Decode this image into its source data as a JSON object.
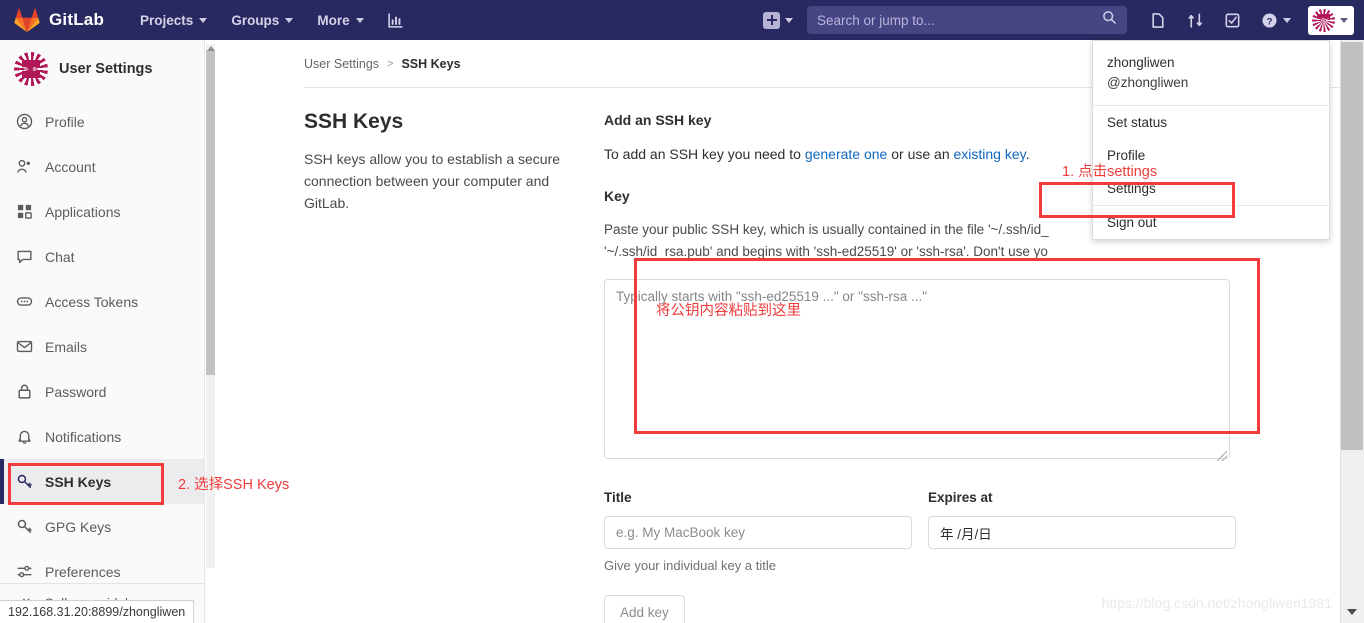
{
  "navbar": {
    "brand": "GitLab",
    "links": [
      {
        "label": "Projects",
        "name": "nav-projects"
      },
      {
        "label": "Groups",
        "name": "nav-groups"
      },
      {
        "label": "More",
        "name": "nav-more"
      }
    ],
    "analytics_icon": "chart-bar-icon",
    "create_new_icon": "plus-square-icon",
    "search": {
      "placeholder": "Search or jump to...",
      "value": "",
      "icon": "search-icon"
    },
    "icons": [
      {
        "name": "issues-icon"
      },
      {
        "name": "merge-requests-icon"
      },
      {
        "name": "todos-icon"
      },
      {
        "name": "help-icon"
      }
    ]
  },
  "user_dropdown": {
    "name": "zhongliwen",
    "handle": "@zhongliwen",
    "items": [
      {
        "label": "Set status"
      },
      {
        "label": "Profile"
      },
      {
        "label": "Settings"
      },
      {
        "label": "Sign out"
      }
    ]
  },
  "sidebar": {
    "title": "User Settings",
    "items": [
      {
        "label": "Profile",
        "icon": "user-circle-icon",
        "active": false
      },
      {
        "label": "Account",
        "icon": "account-key-icon",
        "active": false
      },
      {
        "label": "Applications",
        "icon": "applications-grid-icon",
        "active": false
      },
      {
        "label": "Chat",
        "icon": "chat-bubble-icon",
        "active": false
      },
      {
        "label": "Access Tokens",
        "icon": "token-icon",
        "active": false
      },
      {
        "label": "Emails",
        "icon": "envelope-icon",
        "active": false
      },
      {
        "label": "Password",
        "icon": "lock-icon",
        "active": false
      },
      {
        "label": "Notifications",
        "icon": "bell-icon",
        "active": false
      },
      {
        "label": "SSH Keys",
        "icon": "key-icon",
        "active": true
      },
      {
        "label": "GPG Keys",
        "icon": "key-icon",
        "active": false
      },
      {
        "label": "Preferences",
        "icon": "sliders-icon",
        "active": false
      }
    ],
    "collapse": {
      "label": "Collapse sidebar",
      "icon": "chevron-double-left-icon"
    }
  },
  "breadcrumb": {
    "parent": "User Settings",
    "separator": ">",
    "current": "SSH Keys"
  },
  "panel": {
    "title": "SSH Keys",
    "description": "SSH keys allow you to establish a secure connection between your computer and GitLab."
  },
  "form": {
    "heading": "Add an SSH key",
    "sub_prefix": "To add an SSH key you need to ",
    "sub_link1": "generate one",
    "sub_middle": " or use an ",
    "sub_link2": "existing key",
    "sub_suffix": ".",
    "key_label": "Key",
    "key_help_line1": "Paste your public SSH key, which is usually contained in the file '~/.ssh/id_",
    "key_help_line2": "'~/.ssh/id_rsa.pub' and begins with 'ssh-ed25519' or 'ssh-rsa'. Don't use yo",
    "key_placeholder": "Typically starts with \"ssh-ed25519 ...\" or \"ssh-rsa ...\"",
    "key_value": "",
    "title_label": "Title",
    "title_placeholder": "e.g. My MacBook key",
    "title_value": "",
    "title_help": "Give your individual key a title",
    "expires_label": "Expires at",
    "expires_value": "年 /月/日",
    "submit_label": "Add key"
  },
  "annotations": [
    {
      "text": "1. 点击settings"
    },
    {
      "text": "2. 选择SSH Keys"
    },
    {
      "text": "将公钥内容粘贴到这里"
    }
  ],
  "statusbar": {
    "url": "192.168.31.20:8899/zhongliwen"
  },
  "watermark": {
    "text": "https://blog.csdn.net/zhongliwen1981"
  },
  "colors": {
    "navbar": "#292961",
    "accent_red": "#f23b3b",
    "link_blue": "#1068bf",
    "brand_orange": "#e24329"
  }
}
